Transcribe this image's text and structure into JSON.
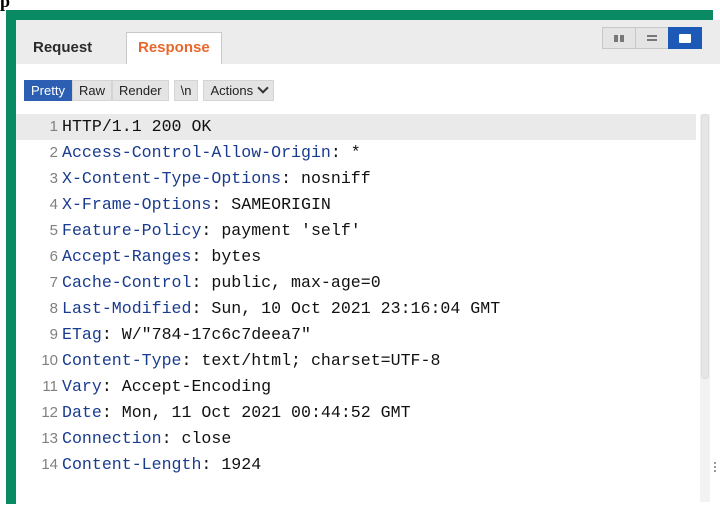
{
  "tabs": [
    {
      "label": "Request",
      "active": false
    },
    {
      "label": "Response",
      "active": true
    }
  ],
  "layout_buttons": [
    "side-by-side-icon",
    "stacked-icon",
    "single-pane-icon"
  ],
  "toolbar": {
    "pretty": "Pretty",
    "raw": "Raw",
    "render": "Render",
    "newline": "\\n",
    "actions": "Actions"
  },
  "lines": [
    {
      "num": "1",
      "name": "HTTP/1.1 200 OK",
      "value": ""
    },
    {
      "num": "2",
      "name": "Access-Control-Allow-Origin",
      "value": ": *"
    },
    {
      "num": "3",
      "name": "X-Content-Type-Options",
      "value": ": nosniff"
    },
    {
      "num": "4",
      "name": "X-Frame-Options",
      "value": ": SAMEORIGIN"
    },
    {
      "num": "5",
      "name": "Feature-Policy",
      "value": ": payment 'self'"
    },
    {
      "num": "6",
      "name": "Accept-Ranges",
      "value": ": bytes"
    },
    {
      "num": "7",
      "name": "Cache-Control",
      "value": ": public, max-age=0"
    },
    {
      "num": "8",
      "name": "Last-Modified",
      "value": ": Sun, 10 Oct 2021 23:16:04 GMT"
    },
    {
      "num": "9",
      "name": "ETag",
      "value": ": W/\"784-17c6c7deea7\""
    },
    {
      "num": "10",
      "name": "Content-Type",
      "value": ": text/html; charset=UTF-8"
    },
    {
      "num": "11",
      "name": "Vary",
      "value": ": Accept-Encoding"
    },
    {
      "num": "12",
      "name": "Date",
      "value": ": Mon, 11 Oct 2021 00:44:52 GMT"
    },
    {
      "num": "13",
      "name": "Connection",
      "value": ": close"
    },
    {
      "num": "14",
      "name": "Content-Length",
      "value": ": 1924"
    }
  ],
  "colors": {
    "accent": "#e8672c",
    "frame": "#0a8a62",
    "selected": "#2c5fb3"
  }
}
